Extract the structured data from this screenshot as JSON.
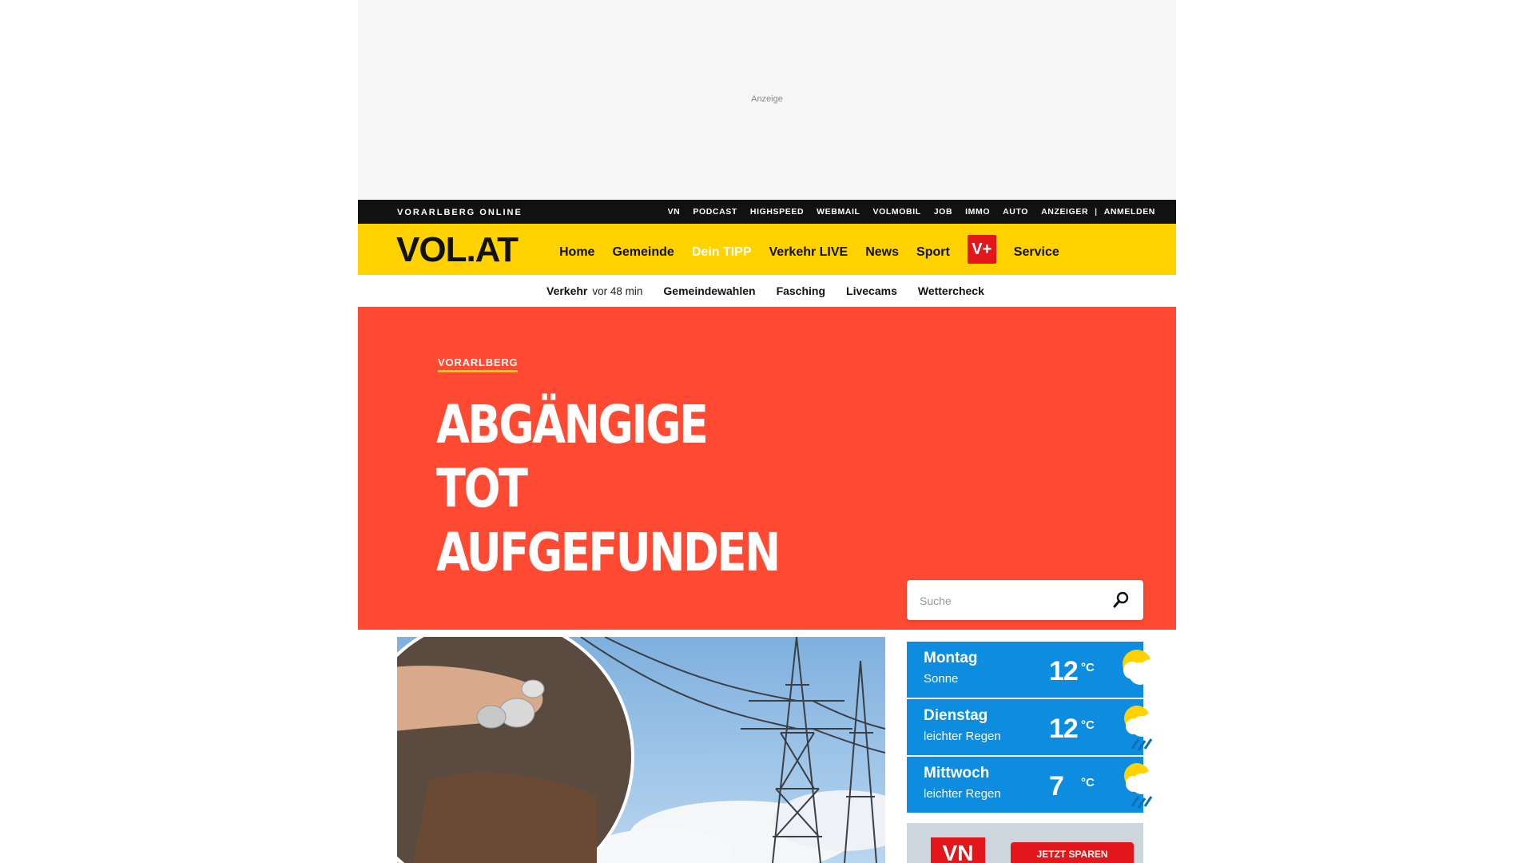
{
  "ad": {
    "label": "Anzeige"
  },
  "topbar": {
    "brand": "VORARLBERG ONLINE",
    "links": [
      "VN",
      "PODCAST",
      "HIGHSPEED",
      "WEBMAIL",
      "VOLMOBIL",
      "JOB",
      "IMMO",
      "AUTO",
      "ANZEIGER"
    ],
    "separator": "|",
    "login": "ANMELDEN"
  },
  "mainnav": {
    "logo": "VOL.AT",
    "items": [
      "Home",
      "Gemeinde",
      "Dein TIPP",
      "Verkehr LIVE",
      "News",
      "Sport"
    ],
    "vplus": "V+",
    "service": "Service",
    "active_item": "Dein TIPP"
  },
  "subnav": {
    "verkehr": "Verkehr",
    "verkehr_time": "vor 48 min",
    "items": [
      "Gemeindewahlen",
      "Fasching",
      "Livecams",
      "Wettercheck"
    ]
  },
  "hero": {
    "kicker": "VORARLBERG",
    "headline": "Abgängige tot aufgefunden"
  },
  "search": {
    "placeholder": "Suche"
  },
  "weather": [
    {
      "day": "Montag",
      "desc": "Sonne",
      "temp": "12",
      "unit": "°C",
      "icon": "sun-cloud-icon"
    },
    {
      "day": "Dienstag",
      "desc": "leichter Regen",
      "temp": "12",
      "unit": "°C",
      "icon": "sun-cloud-rain-icon"
    },
    {
      "day": "Mittwoch",
      "desc": "leichter Regen",
      "temp": "7",
      "unit": "°C",
      "icon": "sun-cloud-rain-icon"
    }
  ],
  "promo": {
    "logo": "VN",
    "button": "JETZT SPAREN"
  },
  "colors": {
    "brand_yellow": "#ffd200",
    "hero_red": "#ff4a33",
    "weather_blue": "#0d8ce0",
    "vplus_red": "#e3161b"
  }
}
